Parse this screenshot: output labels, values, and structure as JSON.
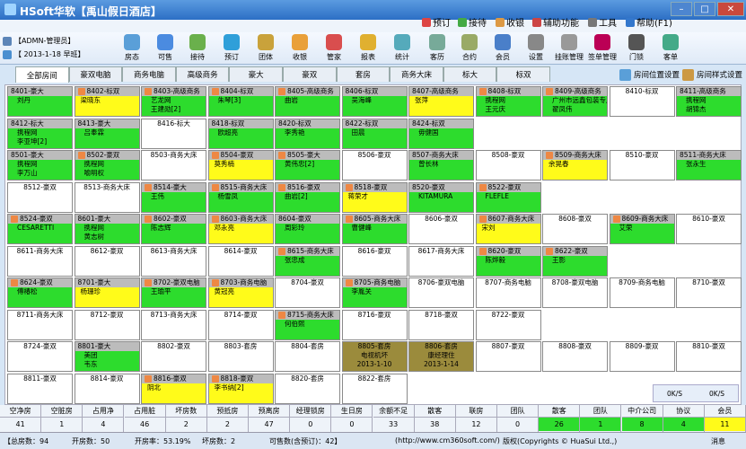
{
  "app_title": "HSoft华软【禹山假日酒店】",
  "top_menu": [
    "预订",
    "接待",
    "收银",
    "辅助功能",
    "工具",
    "帮助(F1)"
  ],
  "user": {
    "name": "【ADMN-管理员】",
    "date": "【 2013-1-18 早班】"
  },
  "toolbar": [
    "房态",
    "可售",
    "接待",
    "预订",
    "团体",
    "收银",
    "管家",
    "报表",
    "统计",
    "客历",
    "合约",
    "会员",
    "设置",
    "挂账管理",
    "签单管理",
    "门锁",
    "客单"
  ],
  "toolbar_colors": [
    "#5a9fd8",
    "#4b8be0",
    "#6ab04c",
    "#2f9fd9",
    "#c9a23b",
    "#e9a03a",
    "#d94e4e",
    "#e0b030",
    "#5ab",
    "#7a9",
    "#9a6",
    "#4a7fc9",
    "#888",
    "#999",
    "#b05",
    "#555",
    "#4a8"
  ],
  "tabs": [
    "全部房间",
    "豪双电脑",
    "商务电脑",
    "高级商务",
    "豪大",
    "豪双",
    "套房",
    "商务大床",
    "标大",
    "标双"
  ],
  "settings": {
    "position": "房间位置设置",
    "style": "房间样式设置"
  },
  "rooms": [
    {
      "h": "8401-豪大",
      "a": "刘丹",
      "b": "",
      "s": "g"
    },
    {
      "h": "8402-标双",
      "a": "梁晓东",
      "b": "",
      "s": "y",
      "i": 1
    },
    {
      "h": "8403-高级商务",
      "a": "艺龙网",
      "b": "王建勋[2]",
      "s": "g",
      "i": 1
    },
    {
      "h": "8404-标双",
      "a": "朱琴[3]",
      "b": "",
      "s": "g",
      "i": 1
    },
    {
      "h": "8405-高级商务",
      "a": "曲岩",
      "b": "",
      "s": "g",
      "i": 1
    },
    {
      "h": "8406-标双",
      "a": "吴海峰",
      "b": "",
      "s": "g"
    },
    {
      "h": "8407-高级商务",
      "a": "张萍",
      "b": "",
      "s": "y"
    },
    {
      "h": "8408-标双",
      "a": "携程网",
      "b": "王元庆",
      "s": "g",
      "i": 1
    },
    {
      "h": "8409-高级商务",
      "a": "广州市远鑫包装专用",
      "b": "翟凤伟",
      "s": "g",
      "i": 1
    },
    {
      "h": "8410-标双",
      "a": "",
      "b": "",
      "s": "w",
      "c": 1
    },
    {
      "h": "8411-高级商务",
      "a": "携程网",
      "b": "胡锦杰",
      "s": "g"
    },
    {
      "h": "8412-标大",
      "a": "携程网",
      "b": "李亚坤[2]",
      "s": "g"
    },
    {
      "h": "8413-豪大",
      "a": "吕奉霖",
      "b": "",
      "s": "g"
    },
    {
      "h": "8416-标大",
      "a": "",
      "b": "",
      "s": "w",
      "c": 1
    },
    {
      "h": "8418-标双",
      "a": "欧超亮",
      "b": "",
      "s": "g"
    },
    {
      "h": "8420-标双",
      "a": "李秀艳",
      "b": "",
      "s": "g"
    },
    {
      "h": "8422-标双",
      "a": "田晨",
      "b": "",
      "s": "g"
    },
    {
      "h": "8424-标双",
      "a": "毋健国",
      "b": "",
      "s": "g"
    },
    {
      "h": "8501-豪大",
      "a": "携程网",
      "b": "李万山",
      "s": "g"
    },
    {
      "h": "8502-豪双",
      "a": "携程网",
      "b": "喻明权",
      "s": "g",
      "i": 1
    },
    {
      "h": "8503-商务大床",
      "a": "",
      "b": "",
      "s": "w",
      "c": 1
    },
    {
      "h": "8504-豪双",
      "a": "莫秀楠",
      "b": "",
      "s": "y",
      "i": 1
    },
    {
      "h": "8505-豪大",
      "a": "黄伟忠[2]",
      "b": "",
      "s": "g",
      "i": 1
    },
    {
      "h": "8506-豪双",
      "a": "",
      "b": "",
      "s": "w",
      "c": 1
    },
    {
      "h": "8507-商务大床",
      "a": "曾长林",
      "b": "",
      "s": "g"
    },
    {
      "h": "8508-豪双",
      "a": "",
      "b": "",
      "s": "w",
      "c": 1
    },
    {
      "h": "8509-商务大床",
      "a": "余晃春",
      "b": "",
      "s": "y",
      "i": 1
    },
    {
      "h": "8510-豪双",
      "a": "",
      "b": "",
      "s": "w",
      "c": 1
    },
    {
      "h": "8511-商务大床",
      "a": "张永生",
      "b": "",
      "s": "g"
    },
    {
      "h": "8512-豪双",
      "a": "",
      "b": "",
      "s": "w",
      "c": 1
    },
    {
      "h": "8513-商务大床",
      "a": "",
      "b": "",
      "s": "w",
      "c": 1
    },
    {
      "h": "8514-豪大",
      "a": "王伟",
      "b": "",
      "s": "g",
      "i": 1
    },
    {
      "h": "8515-商务大床",
      "a": "杨雪凤",
      "b": "",
      "s": "g",
      "i": 1
    },
    {
      "h": "8516-豪双",
      "a": "曲岩[2]",
      "b": "",
      "s": "g",
      "i": 1
    },
    {
      "h": "8518-豪双",
      "a": "蒋荣才",
      "b": "",
      "s": "y",
      "i": 1
    },
    {
      "h": "8520-豪双",
      "a": "KITAMURA",
      "b": "",
      "s": "g"
    },
    {
      "h": "8522-豪双",
      "a": "FLEFLE",
      "b": "",
      "s": "g",
      "i": 1
    },
    {
      "h": "8524-豪双",
      "a": "CESARETTI",
      "b": "",
      "s": "g",
      "i": 1
    },
    {
      "h": "8601-豪大",
      "a": "携程网",
      "b": "黄志树",
      "s": "g"
    },
    {
      "h": "8602-豪双",
      "a": "陈志辉",
      "b": "",
      "s": "g",
      "i": 1
    },
    {
      "h": "8603-商务大床",
      "a": "邓永亮",
      "b": "",
      "s": "y",
      "i": 1
    },
    {
      "h": "8604-豪双",
      "a": "周彩玲",
      "b": "",
      "s": "g"
    },
    {
      "h": "8605-商务大床",
      "a": "曹健峰",
      "b": "",
      "s": "g",
      "i": 1
    },
    {
      "h": "8606-豪双",
      "a": "",
      "b": "",
      "s": "w",
      "c": 1
    },
    {
      "h": "8607-商务大床",
      "a": "宋刘",
      "b": "",
      "s": "y",
      "i": 1
    },
    {
      "h": "8608-豪双",
      "a": "",
      "b": "",
      "s": "w",
      "c": 1
    },
    {
      "h": "8609-商务大床",
      "a": "艾荣",
      "b": "",
      "s": "g",
      "i": 1
    },
    {
      "h": "8610-豪双",
      "a": "",
      "b": "",
      "s": "w",
      "c": 1
    },
    {
      "h": "8611-商务大床",
      "a": "",
      "b": "",
      "s": "w",
      "c": 1
    },
    {
      "h": "8612-豪双",
      "a": "",
      "b": "",
      "s": "w",
      "c": 1
    },
    {
      "h": "8613-商务大床",
      "a": "",
      "b": "",
      "s": "w",
      "c": 1
    },
    {
      "h": "8614-豪双",
      "a": "",
      "b": "",
      "s": "w",
      "c": 1
    },
    {
      "h": "8615-商务大床",
      "a": "张忠成",
      "b": "",
      "s": "g",
      "i": 1
    },
    {
      "h": "8616-豪双",
      "a": "",
      "b": "",
      "s": "w",
      "c": 1
    },
    {
      "h": "8617-商务大床",
      "a": "",
      "b": "",
      "s": "w",
      "c": 1
    },
    {
      "h": "8620-豪双",
      "a": "陈烨毅",
      "b": "",
      "s": "g",
      "i": 1
    },
    {
      "h": "8622-豪双",
      "a": "王影",
      "b": "",
      "s": "g",
      "i": 1
    },
    {
      "h": "8624-豪双",
      "a": "傅椿松",
      "b": "",
      "s": "g",
      "i": 1
    },
    {
      "h": "8701-豪大",
      "a": "杨珊珍",
      "b": "",
      "s": "y"
    },
    {
      "h": "8702-豪双电脑",
      "a": "王瑜平",
      "b": "",
      "s": "g",
      "i": 1
    },
    {
      "h": "8703-商务电脑",
      "a": "黄冠亮",
      "b": "",
      "s": "y",
      "i": 1
    },
    {
      "h": "8704-豪双",
      "a": "",
      "b": "",
      "s": "w",
      "c": 1
    },
    {
      "h": "8705-商务电脑",
      "a": "李胤关",
      "b": "",
      "s": "g",
      "i": 1
    },
    {
      "h": "8706-豪双电脑",
      "a": "",
      "b": "",
      "s": "w",
      "c": 1
    },
    {
      "h": "8707-商务电脑",
      "a": "",
      "b": "",
      "s": "w",
      "c": 1
    },
    {
      "h": "8708-豪双电脑",
      "a": "",
      "b": "",
      "s": "w",
      "c": 1
    },
    {
      "h": "8709-商务电脑",
      "a": "",
      "b": "",
      "s": "w",
      "c": 1
    },
    {
      "h": "8710-豪双",
      "a": "",
      "b": "",
      "s": "w",
      "c": 1
    },
    {
      "h": "8711-商务大床",
      "a": "",
      "b": "",
      "s": "w",
      "c": 1
    },
    {
      "h": "8712-豪双",
      "a": "",
      "b": "",
      "s": "w",
      "c": 1
    },
    {
      "h": "8713-商务大床",
      "a": "",
      "b": "",
      "s": "w",
      "c": 1
    },
    {
      "h": "8714-豪双",
      "a": "",
      "b": "",
      "s": "w",
      "c": 1
    },
    {
      "h": "8715-商务大床",
      "a": "何伯熙",
      "b": "",
      "s": "g",
      "i": 1
    },
    {
      "h": "8716-豪双",
      "a": "",
      "b": "",
      "s": "w",
      "c": 1
    },
    {
      "h": "8718-豪双",
      "a": "",
      "b": "",
      "s": "w",
      "c": 1
    },
    {
      "h": "8722-豪双",
      "a": "",
      "b": "",
      "s": "w",
      "c": 1
    },
    {
      "h": "8724-豪双",
      "a": "",
      "b": "",
      "s": "w",
      "c": 1
    },
    {
      "h": "8801-豪大",
      "a": "美团",
      "b": "韦东",
      "s": "g"
    },
    {
      "h": "8802-豪双",
      "a": "",
      "b": "",
      "s": "w",
      "c": 1
    },
    {
      "h": "8803-套房",
      "a": "",
      "b": "",
      "s": "w",
      "c": 1
    },
    {
      "h": "8804-套房",
      "a": "",
      "b": "",
      "s": "w",
      "c": 1
    },
    {
      "h": "8805-套房",
      "a": "电视机坏",
      "b": "2013-1-10",
      "s": "o",
      "c": 1
    },
    {
      "h": "8806-套房",
      "a": "康经理住",
      "b": "2013-1-14",
      "s": "o",
      "c": 1
    },
    {
      "h": "8807-豪双",
      "a": "",
      "b": "",
      "s": "w",
      "c": 1
    },
    {
      "h": "8808-豪双",
      "a": "",
      "b": "",
      "s": "w",
      "c": 1
    },
    {
      "h": "8809-豪双",
      "a": "",
      "b": "",
      "s": "w",
      "c": 1
    },
    {
      "h": "8810-豪双",
      "a": "",
      "b": "",
      "s": "w",
      "c": 1
    },
    {
      "h": "8811-豪双",
      "a": "",
      "b": "",
      "s": "w",
      "c": 1
    },
    {
      "h": "8814-豪双",
      "a": "",
      "b": "",
      "s": "w",
      "c": 1
    },
    {
      "h": "8816-豪双",
      "a": "阴北",
      "b": "",
      "s": "y",
      "i": 1
    },
    {
      "h": "8818-豪双",
      "a": "李书纳[2]",
      "b": "",
      "s": "y",
      "i": 1
    },
    {
      "h": "8820-套房",
      "a": "",
      "b": "",
      "s": "w",
      "c": 1
    },
    {
      "h": "8822-套房",
      "a": "",
      "b": "",
      "s": "w",
      "c": 1
    }
  ],
  "legend": {
    "a": "0K/S",
    "b": "0K/S"
  },
  "stats": [
    {
      "l": "空净房",
      "v": "41"
    },
    {
      "l": "空脏房",
      "v": "1"
    },
    {
      "l": "占用净",
      "v": "4"
    },
    {
      "l": "占用脏",
      "v": "46"
    },
    {
      "l": "坏房数",
      "v": "2"
    },
    {
      "l": "预抵房",
      "v": "2"
    },
    {
      "l": "预离房",
      "v": "47"
    },
    {
      "l": "经理锁房",
      "v": "0"
    },
    {
      "l": "生日房",
      "v": "0"
    },
    {
      "l": "余额不足",
      "v": "33"
    },
    {
      "l": "散客",
      "v": "38"
    },
    {
      "l": "联房",
      "v": "12"
    },
    {
      "l": "团队",
      "v": "0"
    },
    {
      "l": "散客",
      "v": "26",
      "c": "#2ddc2d"
    },
    {
      "l": "团队",
      "v": "1",
      "c": "#2ddc2d"
    },
    {
      "l": "中介公司",
      "v": "8",
      "c": "#2ddc2d"
    },
    {
      "l": "协议",
      "v": "4",
      "c": "#2ddc2d"
    },
    {
      "l": "会员",
      "v": "11",
      "c": "#fffb1a"
    }
  ],
  "footer": {
    "total": "【总房数：94",
    "open": "开房数：50",
    "rate": "开房率：53.19%",
    "broken": "坏房数：2",
    "sale": "可售数(含预订)：42】",
    "url": "(http://www.cm360soft.com/)",
    "copy": "版权(Copyrights © HuaSui Ltd.,)",
    "msg": "消息"
  }
}
